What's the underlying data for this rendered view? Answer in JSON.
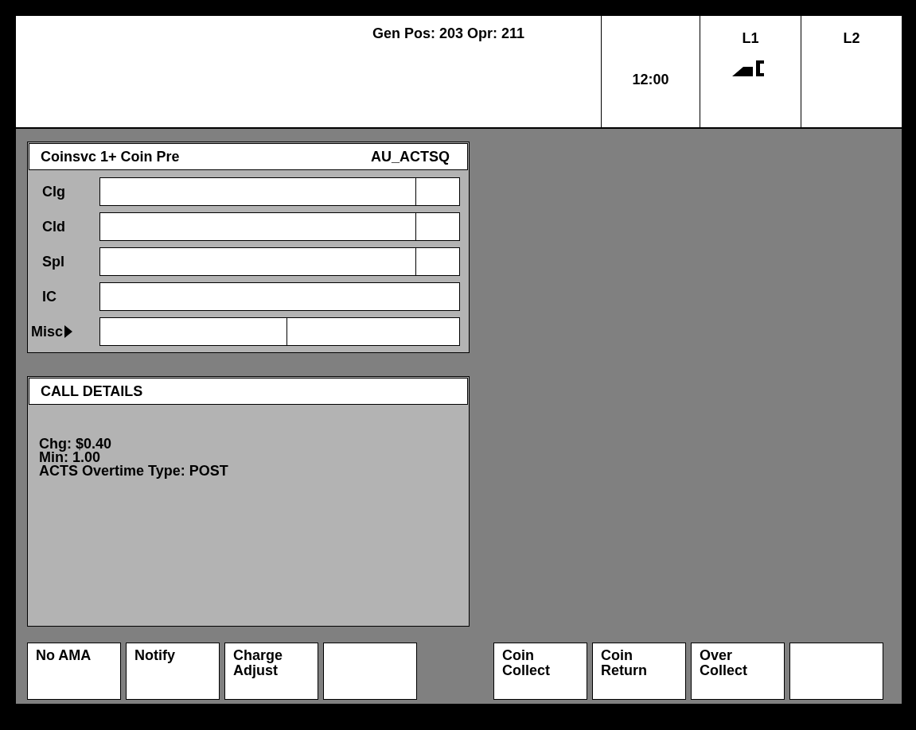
{
  "header": {
    "title": "Gen Pos: 203 Opr: 211",
    "time": "12:00",
    "lines": [
      {
        "label": "L1",
        "kind": "in_use"
      },
      {
        "label": "L2",
        "kind": "idle"
      }
    ]
  },
  "coin_panel": {
    "title": "Coinsvc 1+ Coin Pre",
    "code": "AU_ACTSQ",
    "rows": [
      {
        "label": "Clg",
        "kind": "split"
      },
      {
        "label": "Cld",
        "kind": "split"
      },
      {
        "label": "Spl",
        "kind": "split"
      },
      {
        "label": "IC",
        "kind": "single"
      },
      {
        "label": "Misc",
        "kind": "menu"
      }
    ]
  },
  "call_details": {
    "title": "CALL DETAILS",
    "lines": [
      "Chg: $0.40",
      "Min: 1.00",
      "ACTS Overtime Type: POST"
    ]
  },
  "left_buttons": [
    {
      "kind": "label",
      "lines": [
        "No AMA"
      ]
    },
    {
      "kind": "label",
      "lines": [
        "Notify"
      ]
    },
    {
      "kind": "label",
      "lines": [
        "Charge",
        "Adjust"
      ]
    },
    {
      "kind": "blank"
    }
  ],
  "right_buttons": [
    {
      "kind": "label",
      "lines": [
        "Coin",
        "Collect"
      ]
    },
    {
      "kind": "label",
      "lines": [
        "Coin",
        "Return"
      ]
    },
    {
      "kind": "label",
      "lines": [
        "Over",
        "Collect"
      ]
    },
    {
      "kind": "blank"
    }
  ]
}
